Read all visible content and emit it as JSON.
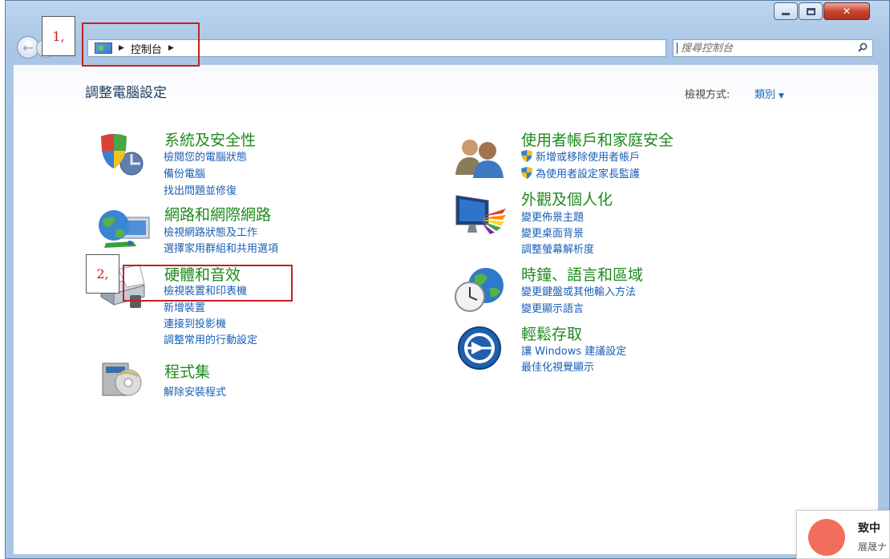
{
  "window": {
    "breadcrumb": [
      "控制台"
    ],
    "search_placeholder": "搜尋控制台"
  },
  "header": {
    "title": "調整電腦設定",
    "view_label": "檢視方式:",
    "view_value": "類別"
  },
  "categories_left": [
    {
      "title": "系統及安全性",
      "links": [
        "檢閱您的電腦狀態",
        "備份電腦",
        "找出問題並修復"
      ]
    },
    {
      "title": "網路和網際網路",
      "links": [
        "檢視網路狀態及工作",
        "選擇家用群組和共用選項"
      ]
    },
    {
      "title": "硬體和音效",
      "links": [
        "檢視裝置和印表機",
        "新增裝置",
        "連接到投影機",
        "調整常用的行動設定"
      ]
    },
    {
      "title": "程式集",
      "links": [
        "解除安裝程式"
      ]
    }
  ],
  "categories_right": [
    {
      "title": "使用者帳戶和家庭安全",
      "links": [
        "新增或移除使用者帳戶",
        "為使用者設定家長監護"
      ]
    },
    {
      "title": "外觀及個人化",
      "links": [
        "變更佈景主題",
        "變更桌面背景",
        "調整螢幕解析度"
      ]
    },
    {
      "title": "時鐘、語言和區域",
      "links": [
        "變更鍵盤或其他輸入方法",
        "變更顯示語言"
      ]
    },
    {
      "title": "輕鬆存取",
      "links": [
        "讓 Windows 建議設定",
        "最佳化視覺顯示"
      ]
    }
  ],
  "annotations": [
    "1,",
    "2,"
  ],
  "widget": {
    "title": "致中",
    "subtitle": "展晟ナ"
  },
  "icons": {
    "system": "shield-pc-icon",
    "network": "globe-network-icon",
    "hardware": "printer-icon",
    "programs": "programs-disc-icon",
    "users": "users-icon",
    "appearance": "monitor-colors-icon",
    "clock": "globe-clock-icon",
    "access": "ease-of-access-icon",
    "uac": "uac-shield-icon"
  },
  "colors": {
    "category_title": "#1e8a1e",
    "link": "#1a5fb4",
    "annotation": "#c42020",
    "widget_dot": "#f26d5b"
  }
}
